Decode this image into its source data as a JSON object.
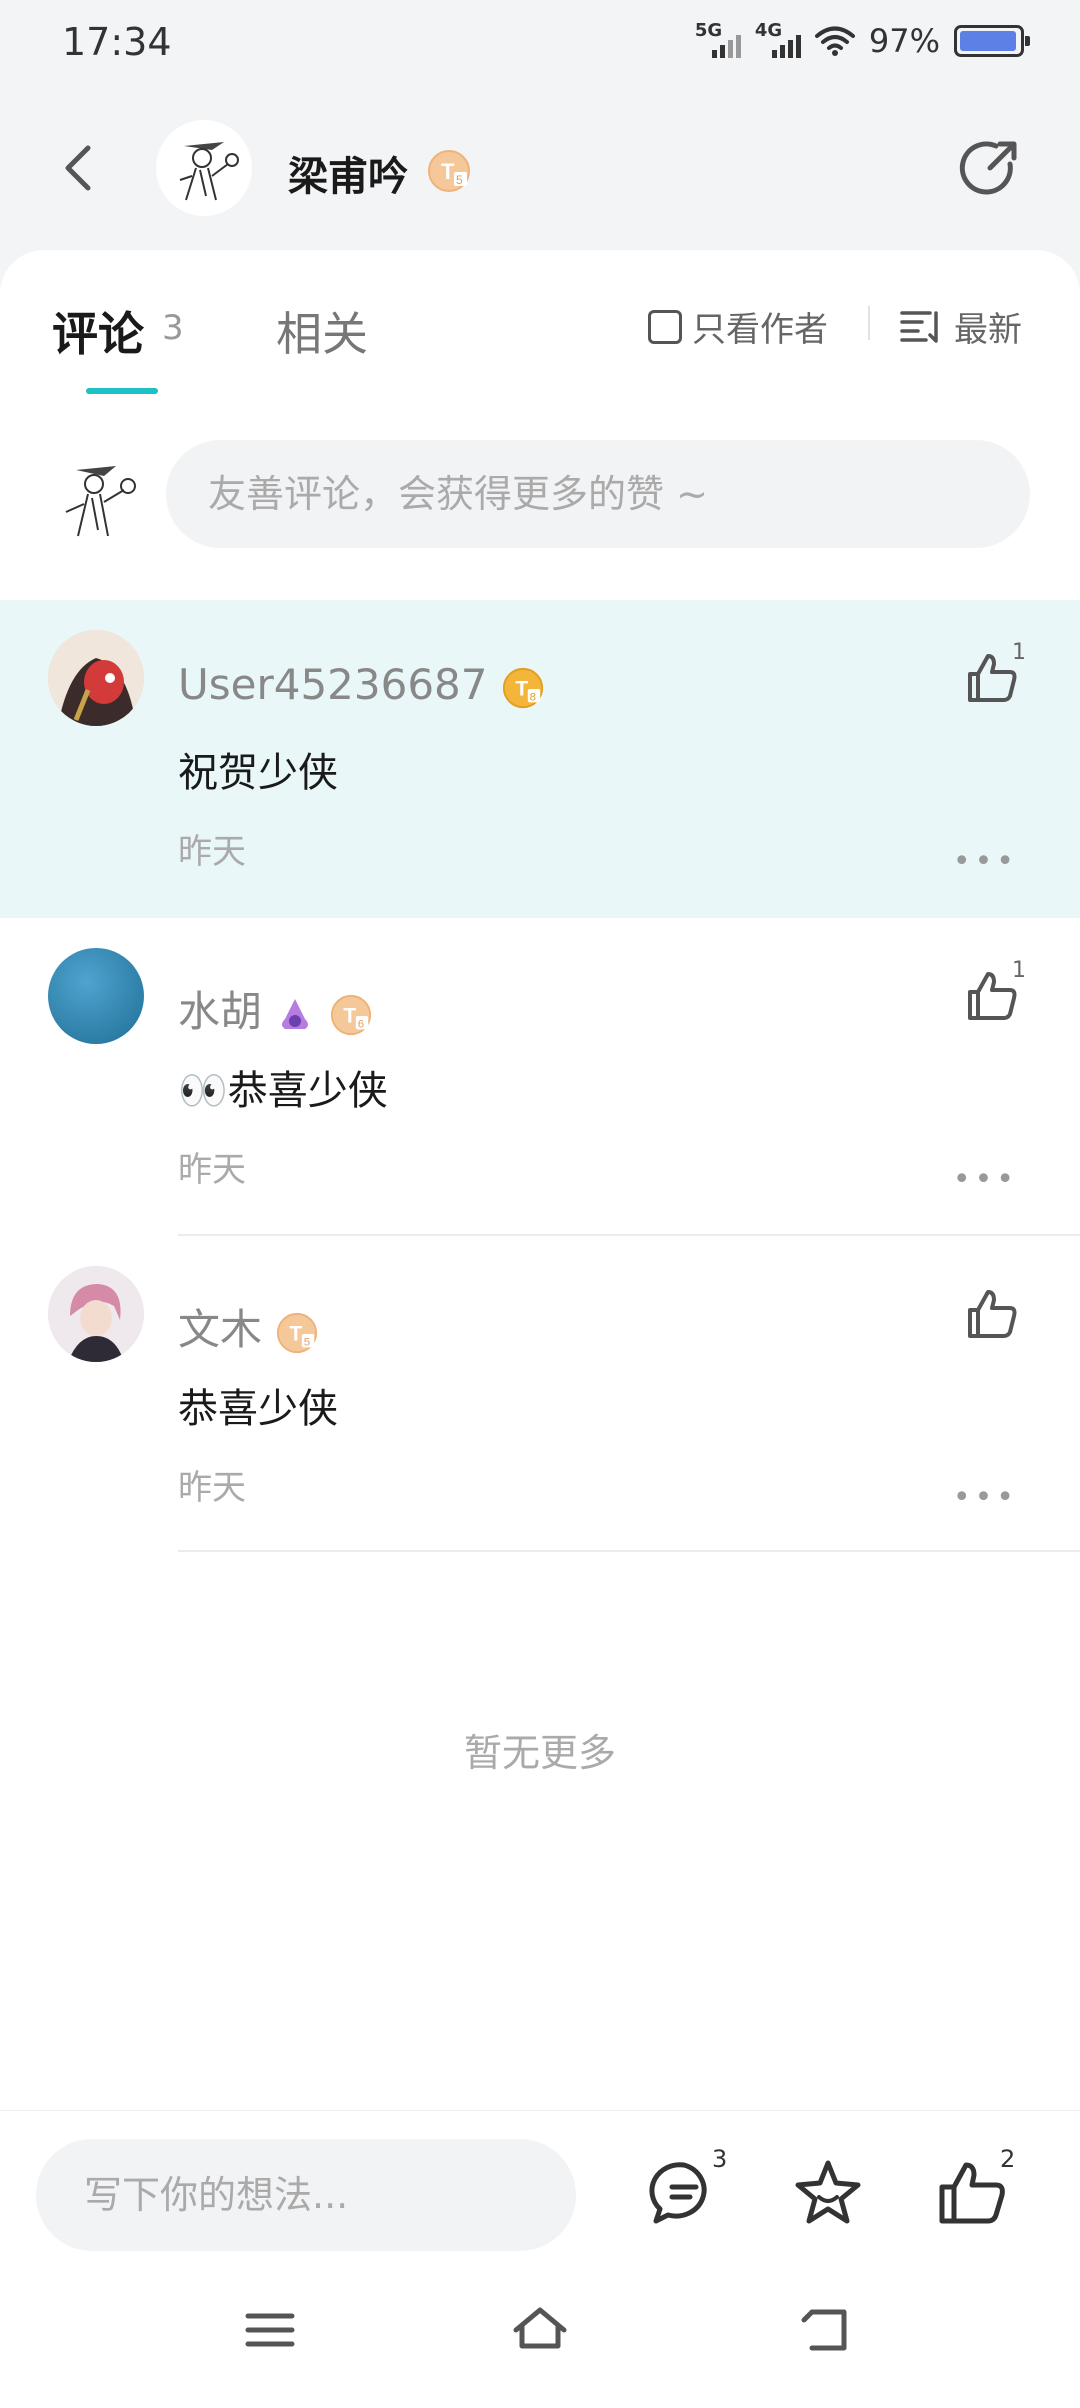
{
  "status_bar": {
    "time": "17:34",
    "sim1_label": "5G",
    "sim2_label": "4G",
    "battery_text": "97%",
    "battery_level": 0.97
  },
  "header": {
    "author_name": "梁甫吟",
    "author_badge": "T5"
  },
  "tabs": {
    "comments_label": "评论",
    "comments_count": "3",
    "related_label": "相关",
    "author_only_label": "只看作者",
    "sort_label": "最新"
  },
  "comment_input": {
    "placeholder": "友善评论，会获得更多的赞 ~"
  },
  "comments": [
    {
      "user": "User45236687",
      "badge": "T8",
      "text": "祝贺少侠",
      "time": "昨天",
      "likes": "1",
      "highlighted": true
    },
    {
      "user": "水胡",
      "badge": "T6",
      "text": "👀恭喜少侠",
      "time": "昨天",
      "likes": "1",
      "highlighted": false
    },
    {
      "user": "文木",
      "badge": "T5",
      "text": "恭喜少侠",
      "time": "昨天",
      "likes": "",
      "highlighted": false
    }
  ],
  "footer_text": "暂无更多",
  "bottom_bar": {
    "write_placeholder": "写下你的想法...",
    "comment_count": "3",
    "like_count": "2"
  },
  "colors": {
    "accent": "#1ec1c3",
    "highlight_bg": "#e9f7f8",
    "badge_gold": "#f0b95a",
    "battery_fill": "#5d80e6"
  },
  "icons": [
    "back-arrow-icon",
    "share-icon",
    "checkbox-icon",
    "sort-icon",
    "thumbs-up-icon",
    "more-icon",
    "comment-icon",
    "star-icon",
    "menu-icon",
    "home-icon",
    "return-icon"
  ]
}
